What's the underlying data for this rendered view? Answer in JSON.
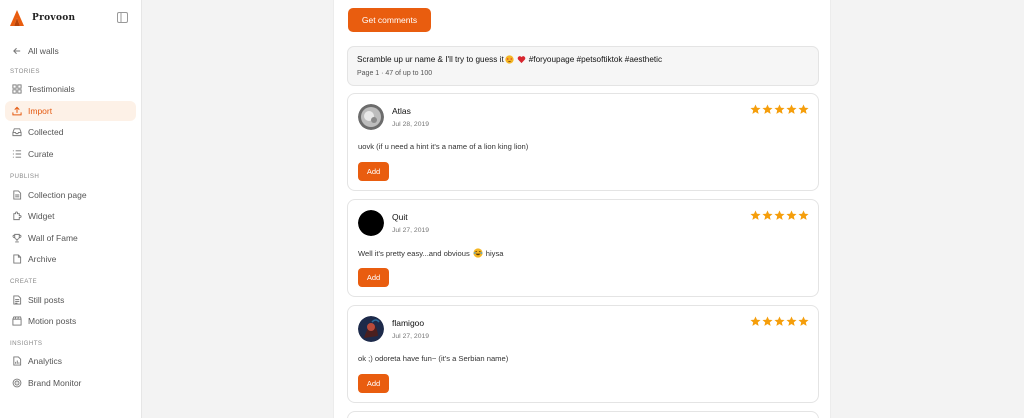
{
  "brand": {
    "name": "Provoon"
  },
  "nav": {
    "back": "All walls",
    "sections": {
      "stories": "STORIES",
      "publish": "PUBLISH",
      "create": "CREATE",
      "insights": "INSIGHTS"
    },
    "items": {
      "testimonials": "Testimonials",
      "import": "Import",
      "collected": "Collected",
      "curate": "Curate",
      "collection_page": "Collection page",
      "widget": "Widget",
      "wall_of_fame": "Wall of Fame",
      "archive": "Archive",
      "still_posts": "Still posts",
      "motion_posts": "Motion posts",
      "analytics": "Analytics",
      "brand_monitor": "Brand Monitor"
    },
    "active": "import"
  },
  "main": {
    "get_comments_label": "Get comments",
    "post": {
      "title_prefix": "Scramble up ur name & I'll try to guess it",
      "title_tags": "#foryoupage #petsoftiktok #aesthetic",
      "page_info": "Page 1 · 47 of up to 100"
    },
    "add_label": "Add",
    "star_color": "#f59e0b",
    "accent": "#e95d0f",
    "comments": [
      {
        "name": "Atlas",
        "date": "Jul 28, 2019",
        "text": "uovk (if u need a hint it's a name of a lion king lion)",
        "rating": 5
      },
      {
        "name": "Quit",
        "date": "Jul 27, 2019",
        "text_before": "Well it's pretty easy...and obvious",
        "text_after": "hiysa",
        "rating": 5
      },
      {
        "name": "flamigoo",
        "date": "Jul 27, 2019",
        "text": "ok ;) odoreta have fun~ (it's a Serbian name)",
        "rating": 5
      }
    ]
  }
}
